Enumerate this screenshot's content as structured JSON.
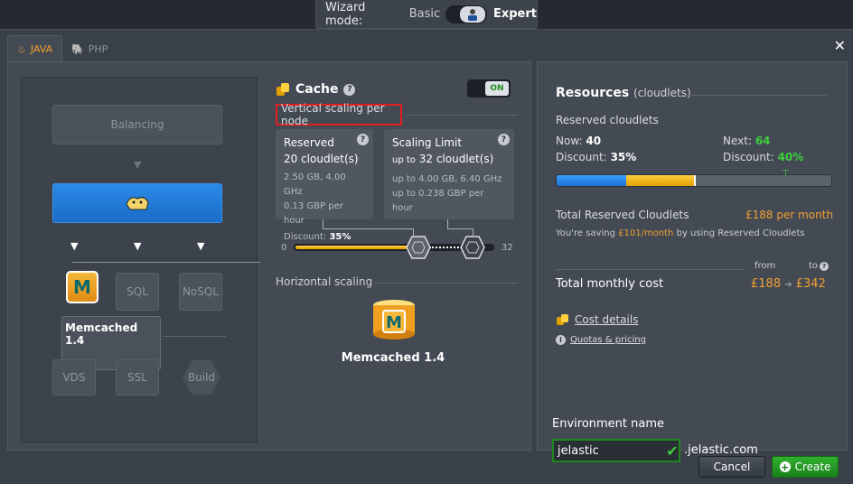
{
  "wizard": {
    "label": "Wizard mode:",
    "basic": "Basic",
    "expert": "Expert"
  },
  "tabs": [
    {
      "label": "JAVA"
    },
    {
      "label": "PHP"
    }
  ],
  "topology": {
    "balancing": "Balancing",
    "sql": "SQL",
    "nosql": "NoSQL",
    "vds": "VDS",
    "ssl": "SSL",
    "build": "Build",
    "memcached_label": "Memcached 1.4",
    "memcached_letter": "M"
  },
  "cache": {
    "title": "Cache",
    "toggle": "ON",
    "vertical_scaling": "Vertical scaling per node",
    "reserved": {
      "title": "Reserved",
      "cloudlets": "20 cloudlet(s)",
      "spec": "2.50 GB, 4.00 GHz",
      "price": "0.13 GBP per hour",
      "discount_label": "Discount:",
      "discount": "35%"
    },
    "scaling_limit": {
      "title": "Scaling Limit",
      "up_to": "up to",
      "cloudlets": "32 cloudlet(s)",
      "spec_prefix": "up to",
      "spec": "4.00 GB, 6.40 GHz",
      "price_prefix": "up to",
      "price": "0.238 GBP per hour"
    },
    "slider_min": "0",
    "slider_max": "32",
    "slider_reserved_fraction": 0.625,
    "slider_limit_fraction": 1.0,
    "horizontal_scaling": "Horizontal scaling",
    "node_label": "Memcached 1.4"
  },
  "resources": {
    "title": "Resources",
    "subtitle": "(cloudlets)",
    "reserved_cloudlets": "Reserved cloudlets",
    "now_label": "Now:",
    "now": "40",
    "next_label": "Next:",
    "next": "64",
    "discount_label": "Discount:",
    "discount_now": "35%",
    "discount_next": "40%",
    "bar_blue_fraction": 0.25,
    "bar_yellow_fraction": 0.5,
    "total_reserved": "Total Reserved Cloudlets",
    "total_reserved_price": "£188 per month",
    "saving_prefix": "You're saving",
    "saving_amount": "£101/month",
    "saving_suffix": "by using Reserved Cloudlets",
    "from": "from",
    "to": "to",
    "total_monthly": "Total monthly cost",
    "cost_from": "£188",
    "cost_to": "£342",
    "cost_details": "Cost details",
    "quotas": "Quotas & pricing",
    "env_name_label": "Environment name",
    "env_name": "jelastic",
    "env_domain": ".jelastic.com"
  },
  "buttons": {
    "cancel": "Cancel",
    "create": "Create"
  }
}
